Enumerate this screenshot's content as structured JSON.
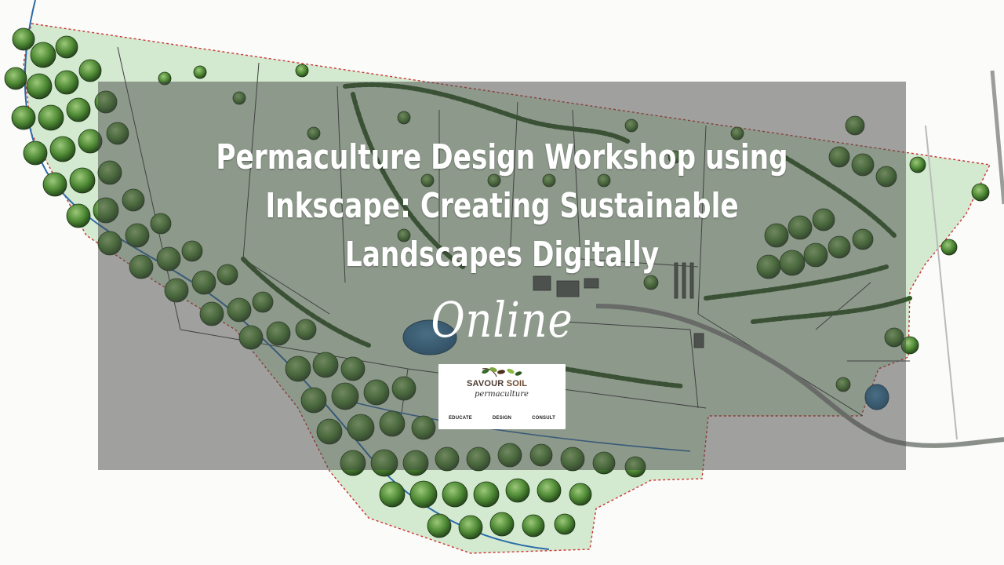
{
  "banner": {
    "title": "Permaculture Design Workshop using Inkscape: Creating Sustainable Landscapes Digitally",
    "subtitle": "Online"
  },
  "logo": {
    "brand_primary": "SAVOUR",
    "brand_secondary": "SOIL",
    "brand_sub": "permaculture",
    "taglines": [
      "EDUCATE",
      "DESIGN",
      "CONSULT"
    ]
  },
  "colors": {
    "overlay": "#464846",
    "text": "#ffffff",
    "parcel_fill": "#d4ead0",
    "boundary": "#cc3333",
    "tree_dark": "#2f5a24",
    "tree_light": "#7fae5c",
    "water": "#2a6f9e",
    "path": "#8a8f8a"
  },
  "icons": [
    "tree-icon",
    "pond-icon",
    "leaf-logo-icon"
  ]
}
